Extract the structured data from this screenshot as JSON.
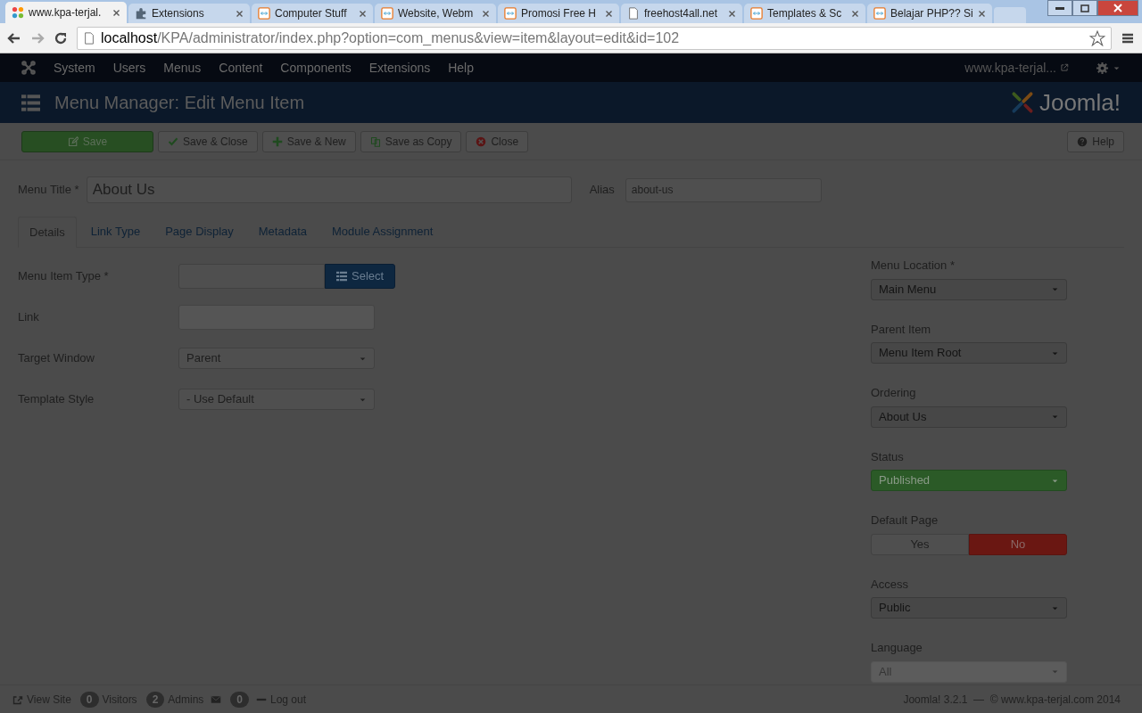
{
  "browser": {
    "tabs": [
      {
        "title": "www.kpa-terjal.",
        "selected": true,
        "kind": "joomla"
      },
      {
        "title": "Extensions",
        "selected": false,
        "kind": "puzzle"
      },
      {
        "title": "Computer Stuff",
        "selected": false,
        "kind": "site"
      },
      {
        "title": "Website, Webm",
        "selected": false,
        "kind": "site"
      },
      {
        "title": "Promosi Free H",
        "selected": false,
        "kind": "site"
      },
      {
        "title": "freehost4all.net",
        "selected": false,
        "kind": "page"
      },
      {
        "title": "Templates & Sc",
        "selected": false,
        "kind": "site"
      },
      {
        "title": "Belajar PHP?? Si",
        "selected": false,
        "kind": "site"
      }
    ],
    "address": {
      "host": "localhost",
      "path": "/KPA/administrator/index.php?option=com_menus&view=item&layout=edit&id=102"
    }
  },
  "admin_menu": [
    "System",
    "Users",
    "Menus",
    "Content",
    "Components",
    "Extensions",
    "Help"
  ],
  "site_link": "www.kpa-terjal...",
  "page_title": "Menu Manager: Edit Menu Item",
  "logo_text": "Joomla!",
  "toolbar": [
    {
      "label": "Save",
      "kind": "save"
    },
    {
      "label": "Save & Close",
      "kind": "save-close"
    },
    {
      "label": "Save & New",
      "kind": "save-new"
    },
    {
      "label": "Save as Copy",
      "kind": "copy"
    },
    {
      "label": "Close",
      "kind": "cancel"
    }
  ],
  "help_button": "Help",
  "menu_title": {
    "label": "Menu Title *",
    "value": "About Us"
  },
  "alias": {
    "label": "Alias",
    "value": "about-us"
  },
  "form_tabs": [
    {
      "label": "Details",
      "selected": true
    },
    {
      "label": "Link Type",
      "selected": false
    },
    {
      "label": "Page Display",
      "selected": false
    },
    {
      "label": "Metadata",
      "selected": false
    },
    {
      "label": "Module Assignment",
      "selected": false
    }
  ],
  "left_fields": [
    {
      "label": "Menu Item Type *",
      "kind": "picker",
      "button": "Select"
    },
    {
      "label": "Link",
      "kind": "text"
    },
    {
      "label": "Target Window",
      "kind": "dropdown",
      "value": "Parent"
    },
    {
      "label": "Template Style",
      "kind": "dropdown",
      "value": "- Use Default"
    }
  ],
  "right_fields": [
    {
      "label": "Menu Location *",
      "kind": "dropdown",
      "value": "Main Menu",
      "disabled": false
    },
    {
      "label": "Parent Item",
      "kind": "dropdown",
      "value": "Menu Item Root",
      "disabled": false
    },
    {
      "label": "Ordering",
      "kind": "dropdown",
      "value": "About Us",
      "disabled": false
    },
    {
      "label": "Status",
      "kind": "status",
      "value": "Published"
    },
    {
      "label": "Default Page",
      "kind": "toggle",
      "options": [
        {
          "label": "Yes",
          "selected": false
        },
        {
          "label": "No",
          "selected": true
        }
      ]
    },
    {
      "label": "Access",
      "kind": "dropdown",
      "value": "Public",
      "disabled": false
    },
    {
      "label": "Language",
      "kind": "dropdown",
      "value": "All",
      "disabled": true
    }
  ],
  "footer": {
    "view_site": "View Site",
    "visitors_count": "0",
    "visitors": "Visitors",
    "admins_count": "2",
    "admins": "Admins",
    "messages_count": "0",
    "logout": "Log out",
    "copyright": "Joomla! 3.2.1  —  © www.kpa-terjal.com 2014"
  }
}
